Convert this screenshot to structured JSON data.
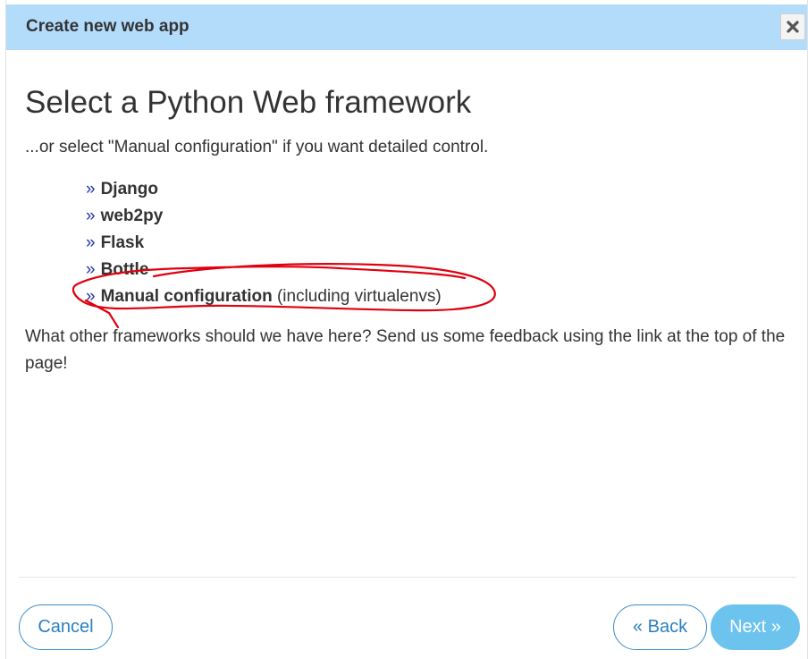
{
  "dialog": {
    "title": "Create new web app",
    "close_icon": "close-icon"
  },
  "main": {
    "heading": "Select a Python Web framework",
    "subtitle": "...or select \"Manual configuration\" if you want detailed control.",
    "list_marker": "»",
    "frameworks": [
      {
        "label": "Django",
        "note": ""
      },
      {
        "label": "web2py",
        "note": ""
      },
      {
        "label": "Flask",
        "note": ""
      },
      {
        "label": "Bottle",
        "note": ""
      },
      {
        "label": "Manual configuration",
        "note": "(including virtualenvs)"
      }
    ],
    "feedback": "What other frameworks should we have here? Send us some feedback using the link at the top of the page!"
  },
  "footer": {
    "cancel_label": "Cancel",
    "back_label": "« Back",
    "next_label": "Next »"
  },
  "colors": {
    "titlebar_bg": "#b3dcfb",
    "accent": "#2a7fc0",
    "next_button_bg": "#6cc3ed",
    "annotation_stroke": "#e0000f"
  }
}
